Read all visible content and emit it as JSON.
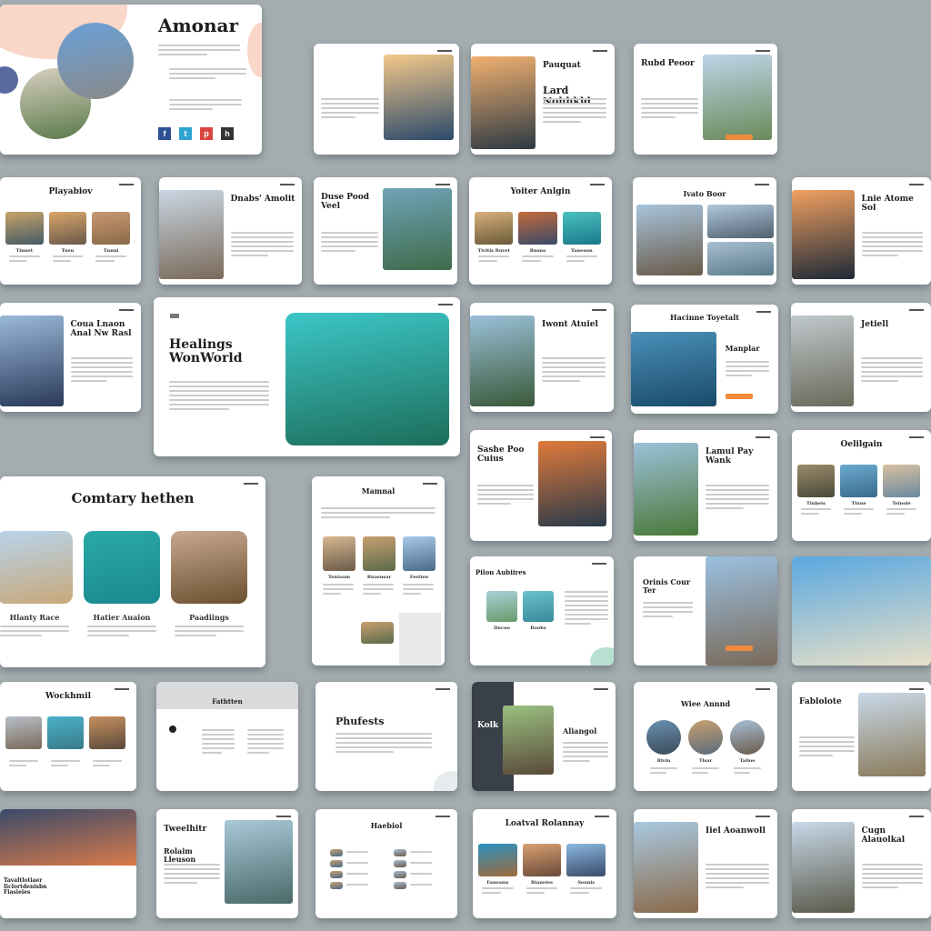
{
  "colors": {
    "background": "#a3acaf",
    "accent": "#f08a3c",
    "peach": "#f8d6c8",
    "navy": "#5a6aa0"
  },
  "featured": {
    "title": "Amonar",
    "social": [
      {
        "icon": "facebook-icon",
        "glyph": "f",
        "color": "#2d4f93"
      },
      {
        "icon": "twitter-icon",
        "glyph": "t",
        "color": "#2fa3cf"
      },
      {
        "icon": "pinterest-icon",
        "glyph": "p",
        "color": "#d9463f"
      },
      {
        "icon": "other-social-icon",
        "glyph": "h",
        "color": "#333333"
      }
    ]
  },
  "slides": [
    {
      "title": "",
      "layout": "split",
      "imgs": [
        [
          "#f4c88a",
          "#2b4a6b"
        ]
      ]
    },
    {
      "title": "Pauquat",
      "sub": "Lard Nohhkld",
      "layout": "imgleft",
      "imgs": [
        [
          "#f0b070",
          "#2e3a44"
        ]
      ]
    },
    {
      "title": "Rubd Peoor",
      "layout": "split",
      "imgs": [
        [
          "#bcd4e8",
          "#6b8a5a"
        ]
      ],
      "button": true
    },
    {
      "title": "Playabiov",
      "layout": "three",
      "imgs": [
        [
          "#c8a468",
          "#445a66"
        ],
        [
          "#d9a56a",
          "#6a5a4a"
        ],
        [
          "#c89870",
          "#8a6a4a"
        ]
      ],
      "caps": [
        "Tinnet",
        "Tuen",
        "Tnnni"
      ]
    },
    {
      "title": "Dnabs' Amolit",
      "layout": "imgleft",
      "imgs": [
        [
          "#c9d6e2",
          "#7a6a5a"
        ]
      ]
    },
    {
      "title": "Duse Pood Veel",
      "layout": "split",
      "imgs": [
        [
          "#6fa3b8",
          "#3f6b4a"
        ]
      ]
    },
    {
      "title": "Yoiter Anlgin",
      "layout": "three",
      "imgs": [
        [
          "#d8b07a",
          "#6a5a3a"
        ],
        [
          "#c46a3a",
          "#3a4a6a"
        ],
        [
          "#4ac0c0",
          "#1a7a8a"
        ]
      ],
      "caps": [
        "Tivitis Ruvet",
        "Rnsno",
        "Taneoon"
      ]
    },
    {
      "title": "Ivato Boor",
      "layout": "grid",
      "imgs": [
        [
          "#a6c4dc",
          "#6a5a4a"
        ],
        [
          "#b0c8dc",
          "#506070"
        ],
        [
          "#a8bfd0",
          "#5a7a8a"
        ]
      ]
    },
    {
      "title": "Lnie Atome Sol",
      "layout": "imgleft",
      "imgs": [
        [
          "#f0a060",
          "#1f2a38"
        ]
      ]
    },
    {
      "title": "Coua Lnaon Anal Nw Rasl",
      "layout": "imgleft",
      "imgs": [
        [
          "#9ab8d8",
          "#2a3a5a"
        ]
      ]
    },
    {
      "title": "Healings WonWorld",
      "layout": "hero",
      "imgs": [
        [
          "#3cc6c8",
          "#1d6e5a"
        ]
      ]
    },
    {
      "title": "Iwont Atuiel",
      "layout": "imgleft",
      "imgs": [
        [
          "#9ac0d8",
          "#3a5a3a"
        ]
      ]
    },
    {
      "title": "Hacinne Toyetalt",
      "sub": "Manplar",
      "layout": "imgleftwide",
      "imgs": [
        [
          "#4a90b8",
          "#1a4a6a"
        ]
      ],
      "button": true
    },
    {
      "title": "Jetiell",
      "layout": "imgleft",
      "imgs": [
        [
          "#c0c8cc",
          "#6a6a5a"
        ]
      ]
    },
    {
      "title": "Sashe Poo Cuius",
      "layout": "split",
      "imgs": [
        [
          "#e07a3a",
          "#2a3a4a"
        ]
      ]
    },
    {
      "title": "Lamul Pay Wank",
      "layout": "imgleft",
      "imgs": [
        [
          "#9cc0d8",
          "#4a7a3a"
        ]
      ]
    },
    {
      "title": "Oelilgain",
      "layout": "three",
      "imgs": [
        [
          "#9a8a6a",
          "#4a4a3a"
        ],
        [
          "#6aaad0",
          "#3a6a8a"
        ],
        [
          "#d8c0a0",
          "#6a8aa0"
        ]
      ],
      "caps": [
        "Tinheis",
        "Tinne",
        "Teinole"
      ]
    },
    {
      "title": "Comtary hethen",
      "layout": "three-big",
      "imgs": [
        [
          "#b8d4ec",
          "#c8a87a"
        ],
        [
          "#2aa8a8",
          "#1a8a90"
        ],
        [
          "#c8a890",
          "#6a5030"
        ]
      ],
      "caps": [
        "Hlanty Race",
        "Hatier Auaion",
        "Paadiings"
      ]
    },
    {
      "title": "Mamnal",
      "layout": "tall",
      "imgs": [
        [
          "#d8b890",
          "#6a5a4a"
        ],
        [
          "#c8a070",
          "#5a6a4a"
        ],
        [
          "#a8c8e8",
          "#4a6a8a"
        ]
      ],
      "caps": [
        "Teniaum",
        "Rnasnsar",
        "Festien"
      ]
    },
    {
      "title": "Pilon Aubiires",
      "layout": "two",
      "imgs": [
        [
          "#a8d0d8",
          "#6a9a6a"
        ],
        [
          "#6ac0d0",
          "#3a8a9a"
        ]
      ],
      "caps": [
        "Dncuo",
        "Roobs"
      ]
    },
    {
      "title": "Orinis Cour Ter",
      "layout": "imgright",
      "imgs": [
        [
          "#9ac0e0",
          "#7a6a5a"
        ]
      ],
      "button": true
    },
    {
      "title": "",
      "layout": "full",
      "imgs": [
        [
          "#5aa8e0",
          "#e8e0c8"
        ]
      ]
    },
    {
      "title": "Wockhmil",
      "layout": "three",
      "imgs": [
        [
          "#b8c0c8",
          "#7a6a5a"
        ],
        [
          "#4ab0c8",
          "#3a7a8a"
        ],
        [
          "#c89060",
          "#5a4a3a"
        ]
      ],
      "caps": [
        "",
        "",
        ""
      ]
    },
    {
      "title": "Fathtten",
      "layout": "list",
      "imgs": []
    },
    {
      "title": "Phufests",
      "layout": "text",
      "imgs": []
    },
    {
      "title": "Kolk",
      "sub": "Aliangol",
      "layout": "dark",
      "imgs": [
        [
          "#9ac080",
          "#5a4a3a"
        ]
      ]
    },
    {
      "title": "Wiee Annnd",
      "layout": "circles",
      "imgs": [
        [
          "#6a90b0",
          "#3a4a5a"
        ],
        [
          "#c8a070",
          "#5a6a7a"
        ],
        [
          "#a8c0d8",
          "#6a5a4a"
        ]
      ],
      "caps": [
        "Rivin",
        "Tlsar",
        "Talioe"
      ]
    },
    {
      "title": "Fablolote",
      "layout": "split",
      "imgs": [
        [
          "#c8d8e8",
          "#8a7a5a"
        ]
      ]
    },
    {
      "title": "Tavaltlotiaer Iiclortdenisbn Fiasieies",
      "layout": "topimg",
      "imgs": [
        [
          "#3a4a6a",
          "#d87a4a"
        ]
      ]
    },
    {
      "title": "Tweelhitr",
      "sub": "Rolaim Lleuson",
      "layout": "split",
      "imgs": [
        [
          "#a8c8d8",
          "#4a6a6a"
        ]
      ]
    },
    {
      "title": "Haebiol",
      "layout": "list2",
      "imgs": []
    },
    {
      "title": "Loatval Rolannay",
      "layout": "three",
      "imgs": [
        [
          "#2a90c0",
          "#a06a3a"
        ],
        [
          "#d8a070",
          "#6a4a3a"
        ],
        [
          "#8ab8e0",
          "#3a4a6a"
        ]
      ],
      "caps": [
        "Faneanu",
        "Rianeies",
        "Sounis"
      ]
    },
    {
      "title": "Iiel Aoanwoll",
      "layout": "imgleft",
      "imgs": [
        [
          "#a8c8e0",
          "#8a6a4a"
        ]
      ]
    },
    {
      "title": "Cugn Alauolkal",
      "layout": "imgleft",
      "imgs": [
        [
          "#c8d8e8",
          "#5a5a4a"
        ]
      ]
    }
  ]
}
